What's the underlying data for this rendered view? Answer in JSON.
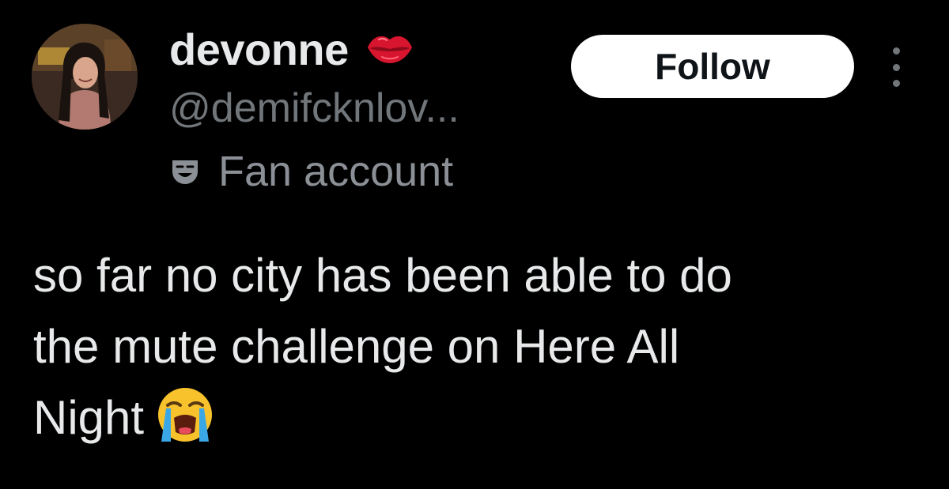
{
  "user": {
    "display_name": "devonne",
    "display_name_emoji": "lips-kiss-icon",
    "handle": "@demifcknlov...",
    "label_icon": "performing-arts-mask-icon",
    "label": "Fan account"
  },
  "actions": {
    "follow_label": "Follow",
    "more_icon": "more-vertical-icon"
  },
  "tweet": {
    "lines": [
      "so far no city has been able to do",
      "the mute challenge on Here All",
      "Night"
    ],
    "trailing_emoji": "loudly-crying-face-icon"
  },
  "colors": {
    "background": "#000000",
    "primary_text": "#e7e9ea",
    "secondary_text": "#71767b",
    "follow_bg": "#ffffff",
    "follow_text": "#0f1419"
  }
}
